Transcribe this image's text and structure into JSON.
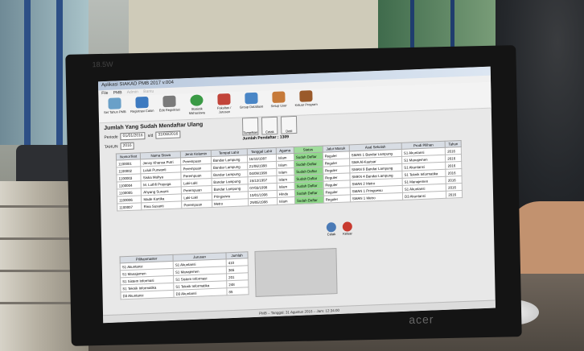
{
  "app": {
    "title": "Aplikasi SIAKAD PMB 2017 v.004"
  },
  "menu": [
    "File",
    "PMB",
    "Admin",
    "Bantu"
  ],
  "toolbar": [
    "Set Tahun PMB",
    "Registrasi Calon",
    "Edit Registrasi",
    "Statistik Mahasiswa",
    "Fakultas / Jurusan",
    "Group Database",
    "Setup User",
    "Keluar Program"
  ],
  "panel": {
    "heading": "Jumlah Yang Sudah Mendaftar Ulang",
    "periode_label": "Periode",
    "date_from": "01/01/2016",
    "sd_label": "s/d",
    "date_to": "31/08/2016",
    "tahun_label": "TAHUN",
    "tahun_value": "2016"
  },
  "buttons": [
    "Tampilkan",
    "Cetak",
    "Detil"
  ],
  "jumlah_pendaftar": {
    "label": "Jumlah Pendaftar :",
    "value": "1309"
  },
  "table": {
    "columns": [
      "NomorTest",
      "Nama Siswa",
      "Jenis Kelamin",
      "Tempat Lahir",
      "Tanggal Lahir",
      "Agama",
      "Status",
      "Jalur Masuk",
      "Asal Sekolah",
      "Prodi Pilihan",
      "Tahun"
    ],
    "rows": [
      [
        "1100001",
        "Jenny Khansa Putri",
        "Perempuan",
        "Bandar Lampung",
        "18/10/1997",
        "Islam",
        "Sudah Daftar",
        "Reguler",
        "SMAN 1 Bandar Lampung",
        "S1 Akuntansi",
        "2016"
      ],
      [
        "1100002",
        "Luluk Purwanti",
        "Perempuan",
        "Bandar Lampung",
        "21/06/1998",
        "Islam",
        "Sudah Daftar",
        "Reguler",
        "SMA Al-Kautsar",
        "S1 Manajemen",
        "2016"
      ],
      [
        "1100003",
        "Siska Mahya",
        "Perempuan",
        "Bandar Lampung",
        "04/09/1998",
        "Islam",
        "Sudah Daftar",
        "Reguler",
        "SMAN 9 Bandar Lampung",
        "S1 Akuntansi",
        "2016"
      ],
      [
        "1100004",
        "M. Luthfi Prayoga",
        "Laki-Laki",
        "Bandar Lampung",
        "15/12/1997",
        "Islam",
        "Sudah Daftar",
        "Reguler",
        "SMKN 4 Bandar Lampung",
        "S1 Teknik Informatika",
        "2016"
      ],
      [
        "1100005",
        "Ahyang Sunarni",
        "Perempuan",
        "Bandar Lampung",
        "07/03/1998",
        "Islam",
        "Sudah Daftar",
        "Reguler",
        "SMAN 2 Metro",
        "S1 Manajemen",
        "2016"
      ],
      [
        "1100006",
        "Made Kartika",
        "Laki-Laki",
        "Pringsewu",
        "10/01/1998",
        "Hindu",
        "Sudah Daftar",
        "Reguler",
        "SMAN 1 Pringsewu",
        "S1 Akuntansi",
        "2016"
      ],
      [
        "1100007",
        "Rina Susanti",
        "Perempuan",
        "Metro",
        "29/05/1998",
        "Islam",
        "Sudah Daftar",
        "Reguler",
        "SMAN 1 Metro",
        "D3 Akuntansi",
        "2016"
      ]
    ]
  },
  "table2": {
    "columns": [
      "Pilihanmaster",
      "Jurusan",
      "Jumlah"
    ],
    "rows": [
      [
        "S1 Akuntansi",
        "S1 Akuntansi",
        "410"
      ],
      [
        "S1 Manajemen",
        "S1 Manajemen",
        "365"
      ],
      [
        "S1 Sistem Informasi",
        "S1 Sistem Informasi",
        "201"
      ],
      [
        "S1 Teknik Informatika",
        "S1 Teknik Informatika",
        "248"
      ],
      [
        "D3 Akuntansi",
        "D3 Akuntansi",
        "85"
      ]
    ]
  },
  "actions": [
    "Cetak",
    "Keluar"
  ],
  "statusbar": "PMB – Tanggal: 31 Agustus 2016 – Jam: 12:34:00",
  "bezel": {
    "brand": "acer",
    "sticker": "18.5W"
  }
}
